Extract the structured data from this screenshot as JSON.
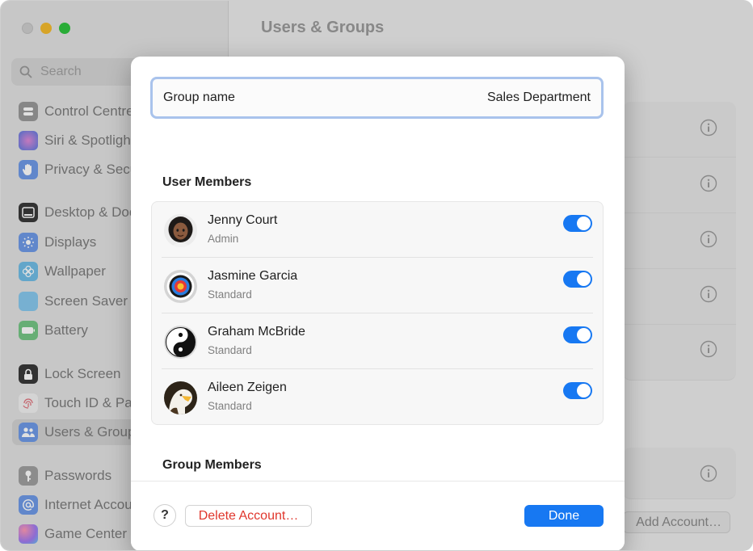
{
  "window": {
    "title": "Users & Groups"
  },
  "sidebar": {
    "search_placeholder": "Search",
    "items": [
      {
        "label": "Control Centre",
        "icon": "control-centre-icon",
        "color": "#8e8e93"
      },
      {
        "label": "Siri & Spotlight",
        "icon": "siri-icon",
        "color": "#b36bd6"
      },
      {
        "label": "Privacy & Security",
        "icon": "hand-icon",
        "color": "#3d7bf5"
      },
      {
        "label": "Desktop & Dock",
        "icon": "dock-icon",
        "color": "#1c1c1e"
      },
      {
        "label": "Displays",
        "icon": "sun-icon",
        "color": "#3d7bf5"
      },
      {
        "label": "Wallpaper",
        "icon": "flower-icon",
        "color": "#33a8e0"
      },
      {
        "label": "Screen Saver",
        "icon": "moon-icon",
        "color": "#5ac8fa"
      },
      {
        "label": "Battery",
        "icon": "battery-icon",
        "color": "#34c759"
      },
      {
        "label": "Lock Screen",
        "icon": "lock-icon",
        "color": "#1c1c1e"
      },
      {
        "label": "Touch ID & Password",
        "icon": "fingerprint-icon",
        "color": "#ffffff"
      },
      {
        "label": "Users & Groups",
        "icon": "users-icon",
        "color": "#3d7bf5"
      },
      {
        "label": "Passwords",
        "icon": "key-icon",
        "color": "#8e8e93"
      },
      {
        "label": "Internet Accounts",
        "icon": "at-icon",
        "color": "#3d7bf5"
      },
      {
        "label": "Game Center",
        "icon": "game-center-icon",
        "color": "#ff6b9d"
      }
    ],
    "selected_index": 10
  },
  "main": {
    "add_account_label": "Add Account…"
  },
  "sheet": {
    "group_name_label": "Group name",
    "group_name_value": "Sales Department",
    "user_members_heading": "User Members",
    "group_members_heading": "Group Members",
    "members": [
      {
        "name": "Jenny Court",
        "role": "Admin",
        "avatar": "memoji-avatar",
        "enabled": true
      },
      {
        "name": "Jasmine Garcia",
        "role": "Standard",
        "avatar": "target-avatar",
        "enabled": true
      },
      {
        "name": "Graham McBride",
        "role": "Standard",
        "avatar": "yin-yang-avatar",
        "enabled": true
      },
      {
        "name": "Aileen Zeigen",
        "role": "Standard",
        "avatar": "eagle-avatar",
        "enabled": true
      }
    ],
    "help_label": "?",
    "delete_label": "Delete Account…",
    "done_label": "Done",
    "accent_color": "#1778f2",
    "destructive_color": "#e0362c"
  }
}
